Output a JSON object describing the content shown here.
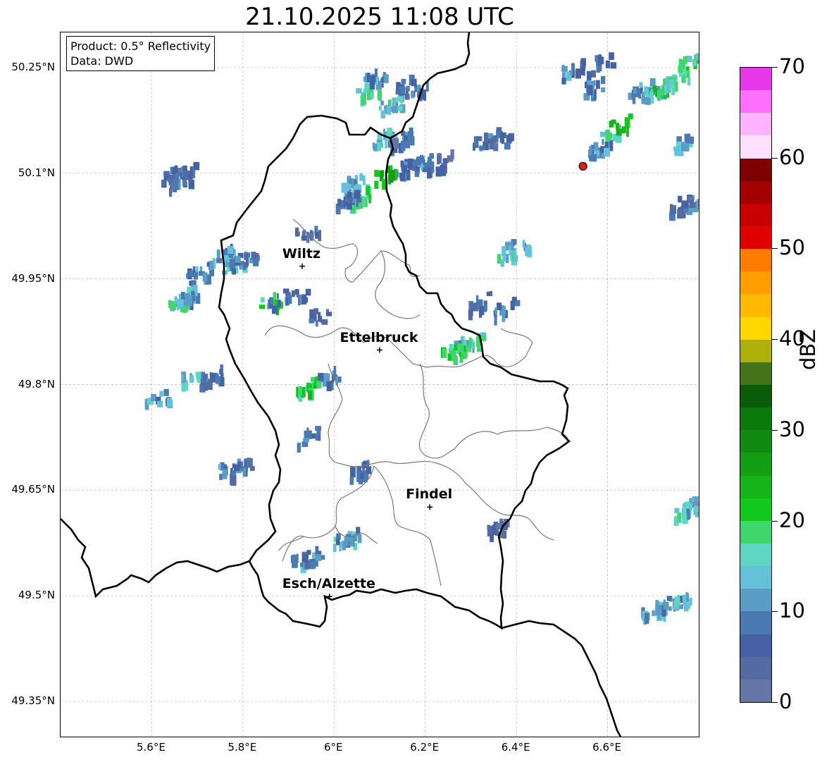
{
  "title": "21.10.2025 11:08 UTC",
  "infobox": {
    "product": "Product: 0.5° Reflectivity",
    "source": "Data: DWD"
  },
  "lat_labels": [
    "50.25°N",
    "50.1°N",
    "49.95°N",
    "49.8°N",
    "49.65°N",
    "49.5°N",
    "49.35°N"
  ],
  "lon_labels": [
    "5.6°E",
    "5.8°E",
    "6°E",
    "6.2°E",
    "6.4°E",
    "6.6°E"
  ],
  "extent": {
    "lon_min": 5.4,
    "lon_max": 6.8,
    "lat_min": 49.3,
    "lat_max": 50.3
  },
  "cities": [
    {
      "name": "Wiltz",
      "lon": 5.93,
      "lat": 49.968
    },
    {
      "name": "Ettelbruck",
      "lon": 6.1,
      "lat": 49.849
    },
    {
      "name": "Findel",
      "lon": 6.21,
      "lat": 49.626
    },
    {
      "name": "Esch/Alzette",
      "lon": 5.99,
      "lat": 49.499
    }
  ],
  "marker": {
    "label": "red-dot",
    "lon": 6.546,
    "lat": 50.11,
    "color": "#e41a1c"
  },
  "colorbar": {
    "title": "dBZ",
    "min": 0,
    "max": 70,
    "tick_labels": [
      "0",
      "10",
      "20",
      "30",
      "40",
      "50",
      "60",
      "70"
    ],
    "colors": [
      "#6475a8",
      "#536aa3",
      "#4563a4",
      "#4a7ab1",
      "#5a9cc5",
      "#65c0da",
      "#5fd5c3",
      "#40d66e",
      "#13c81c",
      "#14b41a",
      "#149e14",
      "#108a10",
      "#0c790c",
      "#0a5c0a",
      "#44731a",
      "#afb00a",
      "#ffd700",
      "#ffba00",
      "#ff9c00",
      "#ff7c00",
      "#e10000",
      "#c80000",
      "#a40000",
      "#7e0000",
      "#ffe0ff",
      "#ffb3ff",
      "#ff6fff",
      "#e837e8"
    ]
  },
  "radar_echoes": [
    {
      "lon": 5.63,
      "lat": 50.098,
      "dbz": 6
    },
    {
      "lon": 5.66,
      "lat": 50.094,
      "dbz": 8
    },
    {
      "lon": 5.67,
      "lat": 50.105,
      "dbz": 5
    },
    {
      "lon": 5.7,
      "lat": 49.96,
      "dbz": 10
    },
    {
      "lon": 5.75,
      "lat": 49.985,
      "dbz": 11
    },
    {
      "lon": 5.78,
      "lat": 49.975,
      "dbz": 13
    },
    {
      "lon": 5.66,
      "lat": 49.92,
      "dbz": 18
    },
    {
      "lon": 5.68,
      "lat": 49.93,
      "dbz": 12
    },
    {
      "lon": 5.8,
      "lat": 49.98,
      "dbz": 8
    },
    {
      "lon": 5.86,
      "lat": 49.92,
      "dbz": 19
    },
    {
      "lon": 5.88,
      "lat": 49.925,
      "dbz": 9
    },
    {
      "lon": 5.92,
      "lat": 49.93,
      "dbz": 7
    },
    {
      "lon": 5.69,
      "lat": 49.815,
      "dbz": 14
    },
    {
      "lon": 5.73,
      "lat": 49.815,
      "dbz": 8
    },
    {
      "lon": 5.61,
      "lat": 49.78,
      "dbz": 12
    },
    {
      "lon": 5.94,
      "lat": 49.8,
      "dbz": 22
    },
    {
      "lon": 5.99,
      "lat": 49.815,
      "dbz": 9
    },
    {
      "lon": 5.94,
      "lat": 49.73,
      "dbz": 8
    },
    {
      "lon": 5.96,
      "lat": 49.9,
      "dbz": 6
    },
    {
      "lon": 5.94,
      "lat": 50.02,
      "dbz": 5
    },
    {
      "lon": 5.77,
      "lat": 49.685,
      "dbz": 11
    },
    {
      "lon": 5.79,
      "lat": 49.685,
      "dbz": 7
    },
    {
      "lon": 6.04,
      "lat": 50.09,
      "dbz": 13
    },
    {
      "lon": 6.05,
      "lat": 50.07,
      "dbz": 18
    },
    {
      "lon": 6.03,
      "lat": 50.065,
      "dbz": 8
    },
    {
      "lon": 6.07,
      "lat": 50.22,
      "dbz": 17
    },
    {
      "lon": 6.09,
      "lat": 50.24,
      "dbz": 10
    },
    {
      "lon": 6.12,
      "lat": 50.2,
      "dbz": 15
    },
    {
      "lon": 6.16,
      "lat": 50.23,
      "dbz": 9
    },
    {
      "lon": 6.18,
      "lat": 50.22,
      "dbz": 8
    },
    {
      "lon": 6.11,
      "lat": 50.155,
      "dbz": 14
    },
    {
      "lon": 6.14,
      "lat": 50.15,
      "dbz": 7
    },
    {
      "lon": 6.15,
      "lat": 50.11,
      "dbz": 9
    },
    {
      "lon": 6.17,
      "lat": 50.115,
      "dbz": 8
    },
    {
      "lon": 6.2,
      "lat": 50.12,
      "dbz": 10
    },
    {
      "lon": 6.23,
      "lat": 50.12,
      "dbz": 6
    },
    {
      "lon": 6.11,
      "lat": 50.1,
      "dbz": 24
    },
    {
      "lon": 6.33,
      "lat": 50.15,
      "dbz": 8
    },
    {
      "lon": 6.36,
      "lat": 50.15,
      "dbz": 6
    },
    {
      "lon": 6.4,
      "lat": 50.0,
      "dbz": 13
    },
    {
      "lon": 6.38,
      "lat": 49.99,
      "dbz": 16
    },
    {
      "lon": 6.37,
      "lat": 49.91,
      "dbz": 10
    },
    {
      "lon": 6.32,
      "lat": 49.92,
      "dbz": 7
    },
    {
      "lon": 6.28,
      "lat": 49.86,
      "dbz": 14
    },
    {
      "lon": 6.3,
      "lat": 49.86,
      "dbz": 17
    },
    {
      "lon": 6.26,
      "lat": 49.85,
      "dbz": 20
    },
    {
      "lon": 6.56,
      "lat": 50.225,
      "dbz": 9
    },
    {
      "lon": 6.58,
      "lat": 50.26,
      "dbz": 7
    },
    {
      "lon": 6.52,
      "lat": 50.25,
      "dbz": 10
    },
    {
      "lon": 6.6,
      "lat": 50.155,
      "dbz": 17
    },
    {
      "lon": 6.62,
      "lat": 50.17,
      "dbz": 22
    },
    {
      "lon": 6.58,
      "lat": 50.14,
      "dbz": 11
    },
    {
      "lon": 6.67,
      "lat": 50.22,
      "dbz": 10
    },
    {
      "lon": 6.7,
      "lat": 50.22,
      "dbz": 14
    },
    {
      "lon": 6.72,
      "lat": 50.23,
      "dbz": 20
    },
    {
      "lon": 6.75,
      "lat": 50.235,
      "dbz": 16
    },
    {
      "lon": 6.78,
      "lat": 50.26,
      "dbz": 19
    },
    {
      "lon": 6.77,
      "lat": 50.15,
      "dbz": 13
    },
    {
      "lon": 6.78,
      "lat": 50.06,
      "dbz": 11
    },
    {
      "lon": 6.76,
      "lat": 50.06,
      "dbz": 7
    },
    {
      "lon": 6.77,
      "lat": 49.625,
      "dbz": 17
    },
    {
      "lon": 6.78,
      "lat": 49.63,
      "dbz": 12
    },
    {
      "lon": 6.7,
      "lat": 49.48,
      "dbz": 13
    },
    {
      "lon": 6.73,
      "lat": 49.49,
      "dbz": 10
    },
    {
      "lon": 6.76,
      "lat": 49.495,
      "dbz": 16
    },
    {
      "lon": 6.05,
      "lat": 49.68,
      "dbz": 8
    },
    {
      "lon": 6.02,
      "lat": 49.58,
      "dbz": 14
    },
    {
      "lon": 6.03,
      "lat": 49.585,
      "dbz": 9
    },
    {
      "lon": 5.93,
      "lat": 49.555,
      "dbz": 12
    },
    {
      "lon": 5.95,
      "lat": 49.56,
      "dbz": 8
    },
    {
      "lon": 6.36,
      "lat": 49.6,
      "dbz": 6
    }
  ]
}
